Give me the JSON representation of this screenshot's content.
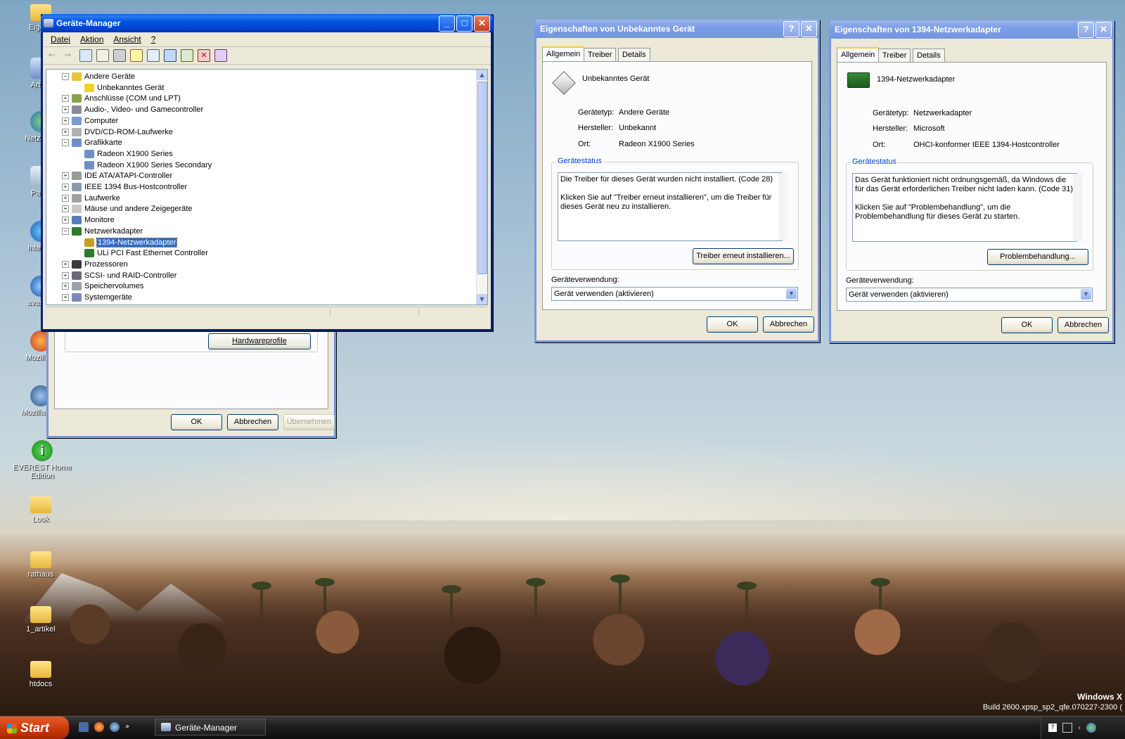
{
  "desktop": {
    "icons": [
      {
        "label": "Eigene"
      },
      {
        "label": "Arbeit"
      },
      {
        "label": "Netzwerk"
      },
      {
        "label": "Papie"
      },
      {
        "label": "Internet"
      },
      {
        "label": "avast! A"
      },
      {
        "label": "Mozilla F"
      },
      {
        "label": "Mozilla Thu"
      },
      {
        "label": "EVEREST Home Edition"
      },
      {
        "label": "Look"
      },
      {
        "label": "rathaus"
      },
      {
        "label": "1_artikel"
      },
      {
        "label": "htdocs"
      }
    ],
    "watermark_line1": "Windows X",
    "watermark_line2": "Build 2600.xpsp_sp2_qfe.070227-2300 ("
  },
  "behind_dialog": {
    "hardware_profiles_button": "Hardwareprofile",
    "ok": "OK",
    "cancel": "Abbrechen",
    "apply": "Übernehmen"
  },
  "device_manager": {
    "title": "Geräte-Manager",
    "menu": [
      "Datei",
      "Aktion",
      "Ansicht",
      "?"
    ],
    "tree": [
      {
        "label": "Andere Geräte",
        "level": 1,
        "expander": "−",
        "icon": "question-icon"
      },
      {
        "label": "Unbekanntes Gerät",
        "level": 2,
        "expander": "",
        "icon": "warning-icon"
      },
      {
        "label": "Anschlüsse (COM und LPT)",
        "level": 1,
        "expander": "+",
        "icon": "port-icon"
      },
      {
        "label": "Audio-, Video- und Gamecontroller",
        "level": 1,
        "expander": "+",
        "icon": "speaker-icon"
      },
      {
        "label": "Computer",
        "level": 1,
        "expander": "+",
        "icon": "computer-icon"
      },
      {
        "label": "DVD/CD-ROM-Laufwerke",
        "level": 1,
        "expander": "+",
        "icon": "disc-icon"
      },
      {
        "label": "Grafikkarte",
        "level": 1,
        "expander": "−",
        "icon": "display-adapter-icon"
      },
      {
        "label": "Radeon X1900 Series",
        "level": 2,
        "expander": "",
        "icon": "display-adapter-icon"
      },
      {
        "label": "Radeon X1900 Series Secondary",
        "level": 2,
        "expander": "",
        "icon": "display-adapter-icon"
      },
      {
        "label": "IDE ATA/ATAPI-Controller",
        "level": 1,
        "expander": "+",
        "icon": "ide-icon"
      },
      {
        "label": "IEEE 1394 Bus-Hostcontroller",
        "level": 1,
        "expander": "+",
        "icon": "firewire-icon"
      },
      {
        "label": "Laufwerke",
        "level": 1,
        "expander": "+",
        "icon": "drive-icon"
      },
      {
        "label": "Mäuse und andere Zeigegeräte",
        "level": 1,
        "expander": "+",
        "icon": "mouse-icon"
      },
      {
        "label": "Monitore",
        "level": 1,
        "expander": "+",
        "icon": "monitor-icon"
      },
      {
        "label": "Netzwerkadapter",
        "level": 1,
        "expander": "−",
        "icon": "network-card-icon"
      },
      {
        "label": "1394-Netzwerkadapter",
        "level": 2,
        "expander": "",
        "icon": "network-card-warning-icon",
        "selected": true
      },
      {
        "label": "ULi PCI Fast Ethernet Controller",
        "level": 2,
        "expander": "",
        "icon": "network-card-icon"
      },
      {
        "label": "Prozessoren",
        "level": 1,
        "expander": "+",
        "icon": "cpu-icon"
      },
      {
        "label": "SCSI- und RAID-Controller",
        "level": 1,
        "expander": "+",
        "icon": "scsi-icon"
      },
      {
        "label": "Speichervolumes",
        "level": 1,
        "expander": "+",
        "icon": "volume-icon"
      },
      {
        "label": "Systemgeräte",
        "level": 1,
        "expander": "+",
        "icon": "system-icon"
      }
    ]
  },
  "props_unknown": {
    "title": "Eigenschaften von Unbekanntes Gerät",
    "tabs": [
      "Allgemein",
      "Treiber",
      "Details"
    ],
    "device_name": "Unbekanntes Gerät",
    "rows": [
      {
        "key": "Gerätetyp:",
        "value": "Andere Geräte"
      },
      {
        "key": "Hersteller:",
        "value": "Unbekannt"
      },
      {
        "key": "Ort:",
        "value": "Radeon X1900 Series"
      }
    ],
    "status_title": "Gerätestatus",
    "status_text": "Die Treiber für dieses Gerät wurden nicht installiert. (Code 28)\n\nKlicken Sie auf \"Treiber erneut installieren\", um die Treiber für dieses Gerät neu zu installieren.",
    "action_button": "Treiber erneut installieren...",
    "usage_label": "Geräteverwendung:",
    "usage_value": "Gerät verwenden (aktivieren)",
    "ok": "OK",
    "cancel": "Abbrechen"
  },
  "props_1394": {
    "title": "Eigenschaften von 1394-Netzwerkadapter",
    "tabs": [
      "Allgemein",
      "Treiber",
      "Details"
    ],
    "device_name": "1394-Netzwerkadapter",
    "rows": [
      {
        "key": "Gerätetyp:",
        "value": "Netzwerkadapter"
      },
      {
        "key": "Hersteller:",
        "value": "Microsoft"
      },
      {
        "key": "Ort:",
        "value": "OHCI-konformer IEEE 1394-Hostcontroller"
      }
    ],
    "status_title": "Gerätestatus",
    "status_text": "Das Gerät funktioniert nicht ordnungsgemäß, da Windows die für das Gerät erforderlichen Treiber nicht laden kann. (Code 31)\n\nKlicken Sie auf \"Problembehandlung\", um die Problembehandlung für dieses Gerät zu starten.",
    "action_button": "Problembehandlung...",
    "usage_label": "Geräteverwendung:",
    "usage_value": "Gerät verwenden (aktivieren)",
    "ok": "OK",
    "cancel": "Abbrechen"
  },
  "taskbar": {
    "start_label": "Start",
    "tasks": [
      {
        "label": "Geräte-Manager"
      }
    ]
  },
  "colors": {
    "xp_blue": "#0054e3",
    "selection": "#316ac5",
    "group_title": "#0046d5"
  }
}
